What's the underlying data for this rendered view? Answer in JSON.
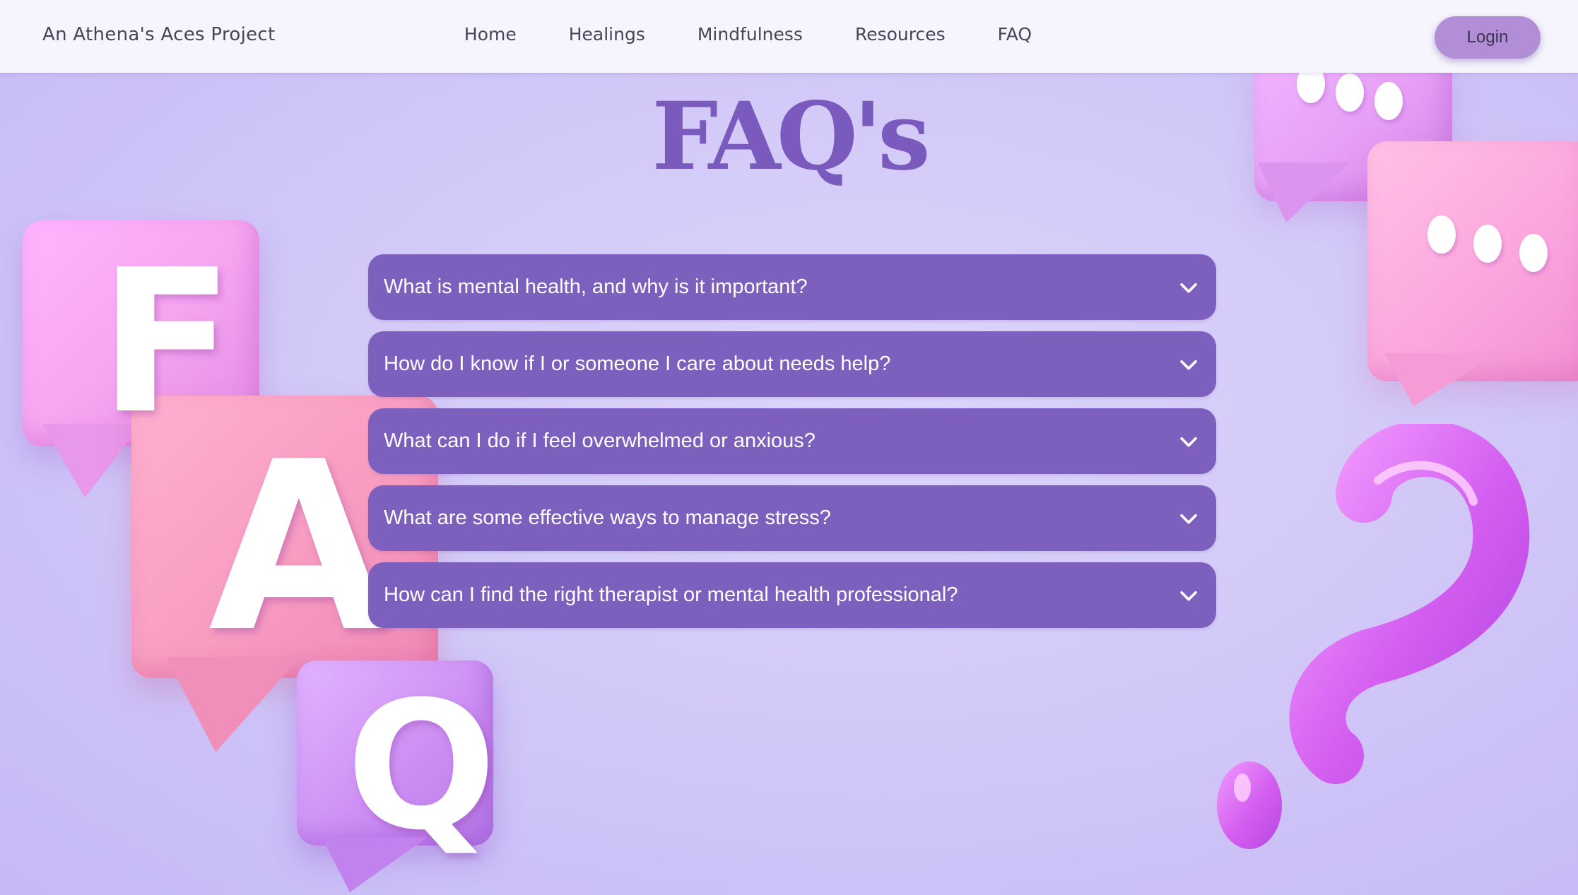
{
  "header": {
    "brand": "An Athena's Aces Project",
    "nav": [
      "Home",
      "Healings",
      "Mindfulness",
      "Resources",
      "FAQ"
    ],
    "login_label": "Login"
  },
  "main": {
    "title": "FAQ's",
    "faqs": [
      "What is mental health, and why is it important?",
      "How do I know if I or someone I care about needs help?",
      "What can I do if I feel overwhelmed or anxious?",
      "What are some effective ways to manage stress?",
      "How can I find the right therapist or mental health professional?"
    ]
  },
  "decoration": {
    "letters": [
      "F",
      "A",
      "Q"
    ],
    "icons": [
      "speech-bubble-icon",
      "question-mark-icon",
      "chevron-down-icon"
    ]
  },
  "colors": {
    "accent": "#7d60bd",
    "title": "#7a5bbd",
    "login": "#b28ed7",
    "header_bg": "#f6f4fd",
    "page_bg": "#d2c9f8"
  }
}
